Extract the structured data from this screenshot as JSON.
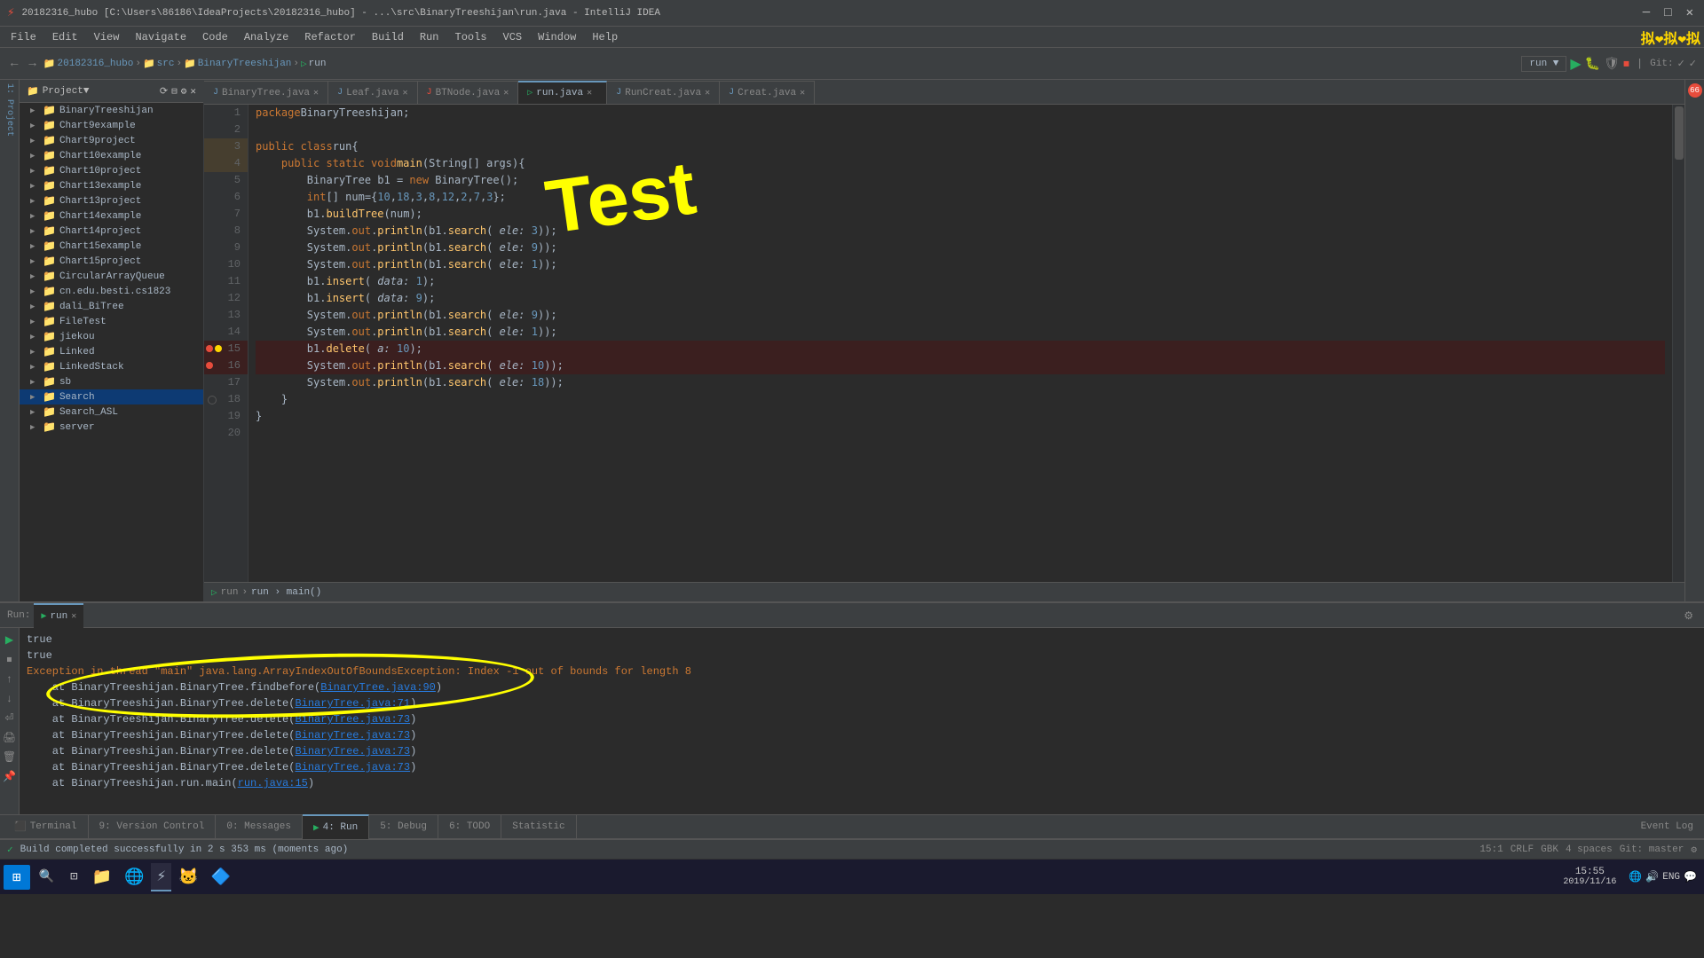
{
  "titlebar": {
    "title": "20182316_hubo [C:\\Users\\86186\\IdeaProjects\\20182316_hubo] - ...\\src\\BinaryTreeshijan\\run.java - IntelliJ IDEA",
    "min": "—",
    "max": "□",
    "close": "✕"
  },
  "menubar": {
    "items": [
      "File",
      "Edit",
      "View",
      "Navigate",
      "Code",
      "Analyze",
      "Refactor",
      "Build",
      "Run",
      "Tools",
      "VCS",
      "Window",
      "Help"
    ]
  },
  "toolbar": {
    "project_name": "20182316_hubo",
    "src": "src",
    "module": "BinaryTreeshijan",
    "run_label": "run",
    "run_config": "run"
  },
  "project_panel": {
    "header": "Project",
    "items": [
      "BinaryTreeshijan",
      "Chart9example",
      "Chart9project",
      "Chart10example",
      "Chart10project",
      "Chart13example",
      "Chart13project",
      "Chart14example",
      "Chart14project",
      "Chart15example",
      "Chart15project",
      "CircularArrayQueue",
      "cn.edu.besti.cs1823",
      "dali_BiTree",
      "FileTest",
      "jiekou",
      "Linked",
      "LinkedStack",
      "sb",
      "Search",
      "Search_ASL",
      "server"
    ]
  },
  "tabs": [
    {
      "label": "BinaryTree.java",
      "active": false,
      "modified": false
    },
    {
      "label": "Leaf.java",
      "active": false,
      "modified": false
    },
    {
      "label": "BTNode.java",
      "active": false,
      "modified": true
    },
    {
      "label": "run.java",
      "active": true,
      "modified": false
    },
    {
      "label": "RunCreat.java",
      "active": false,
      "modified": false
    },
    {
      "label": "Creat.java",
      "active": false,
      "modified": false
    }
  ],
  "code": {
    "package": "package BinaryTreeshijan;",
    "lines": [
      {
        "num": "1",
        "text": "package BinaryTreeshijan;",
        "error": false
      },
      {
        "num": "2",
        "text": "",
        "error": false
      },
      {
        "num": "3",
        "text": "public class run {",
        "error": false
      },
      {
        "num": "4",
        "text": "    public static void main(String[] args){",
        "error": false
      },
      {
        "num": "5",
        "text": "        BinaryTree b1 = new BinaryTree();",
        "error": false
      },
      {
        "num": "6",
        "text": "        int[] num={10,18,3,8,12,2,7,3};",
        "error": false
      },
      {
        "num": "7",
        "text": "        b1.buildTree(num);",
        "error": false
      },
      {
        "num": "8",
        "text": "        System.out.println(b1.search( ele: 3));",
        "error": false
      },
      {
        "num": "9",
        "text": "        System.out.println(b1.search( ele: 9));",
        "error": false
      },
      {
        "num": "10",
        "text": "        System.out.println(b1.search( ele: 1));",
        "error": false
      },
      {
        "num": "11",
        "text": "        b1.insert( data: 1);",
        "error": false
      },
      {
        "num": "12",
        "text": "        b1.insert( data: 9);",
        "error": false
      },
      {
        "num": "13",
        "text": "        System.out.println(b1.search( ele: 9));",
        "error": false
      },
      {
        "num": "14",
        "text": "        System.out.println(b1.search( ele: 1));",
        "error": false
      },
      {
        "num": "15",
        "text": "        b1.delete( a: 10);",
        "error": true
      },
      {
        "num": "16",
        "text": "        System.out.println(b1.search( ele: 10));",
        "error": true
      },
      {
        "num": "17",
        "text": "        System.out.println(b1.search( ele: 18));",
        "error": false
      },
      {
        "num": "18",
        "text": "    }",
        "error": false
      },
      {
        "num": "19",
        "text": "}",
        "error": false
      },
      {
        "num": "20",
        "text": "",
        "error": false
      }
    ]
  },
  "editor_status": {
    "breadcrumb": "run › main()"
  },
  "bottom_panel": {
    "run_label": "Run:",
    "run_tab": "run",
    "tabs": [
      {
        "label": "Terminal",
        "num": ""
      },
      {
        "label": "9: Version Control",
        "num": "9"
      },
      {
        "label": "0: Messages",
        "num": "0"
      },
      {
        "label": "4: Run",
        "num": "4",
        "active": true
      },
      {
        "label": "5: Debug",
        "num": "5"
      },
      {
        "label": "6: TODO",
        "num": "6"
      },
      {
        "label": "Statistic",
        "num": ""
      }
    ],
    "output": [
      {
        "type": "normal",
        "text": "true"
      },
      {
        "type": "normal",
        "text": "true"
      },
      {
        "type": "error",
        "text": "Exception in thread \"main\" java.lang.ArrayIndexOutOfBoundsException: Index -1 out of bounds for length 8"
      },
      {
        "type": "stack",
        "text": "\tat BinaryTreeshijan.BinaryTree.findbefore(",
        "link": "BinaryTree.java:90",
        "end": ")"
      },
      {
        "type": "stack",
        "text": "\tat BinaryTreeshijan.BinaryTree.delete(",
        "link": "BinaryTree.java:71",
        "end": ")"
      },
      {
        "type": "stack",
        "text": "\tat BinaryTreeshijan.BinaryTree.delete(",
        "link": "BinaryTree.java:73",
        "end": ")"
      },
      {
        "type": "stack",
        "text": "\tat BinaryTreeshijan.BinaryTree.delete(",
        "link": "BinaryTree.java:73",
        "end": ")"
      },
      {
        "type": "stack",
        "text": "\tat BinaryTreeshijan.BinaryTree.delete(",
        "link": "BinaryTree.java:73",
        "end": ")"
      },
      {
        "type": "stack",
        "text": "\tat BinaryTreeshijan.BinaryTree.delete(",
        "link": "BinaryTree.java:73",
        "end": ")"
      },
      {
        "type": "stack",
        "text": "\tat BinaryTreeshijan.run.main(",
        "link": "run.java:15",
        "end": ")"
      }
    ]
  },
  "status_bar": {
    "position": "15:1",
    "crlf": "CRLF",
    "encoding": "GBK",
    "indent": "4 spaces",
    "git": "Git: master",
    "build_status": "Build completed successfully in 2 s 353 ms (moments ago)"
  },
  "taskbar": {
    "time": "15:55",
    "date": "2019/11/16",
    "lang": "ENG"
  },
  "annotation": {
    "yellow_text": "Test",
    "circle_text": "Index -1 out of bounds for length 8"
  }
}
